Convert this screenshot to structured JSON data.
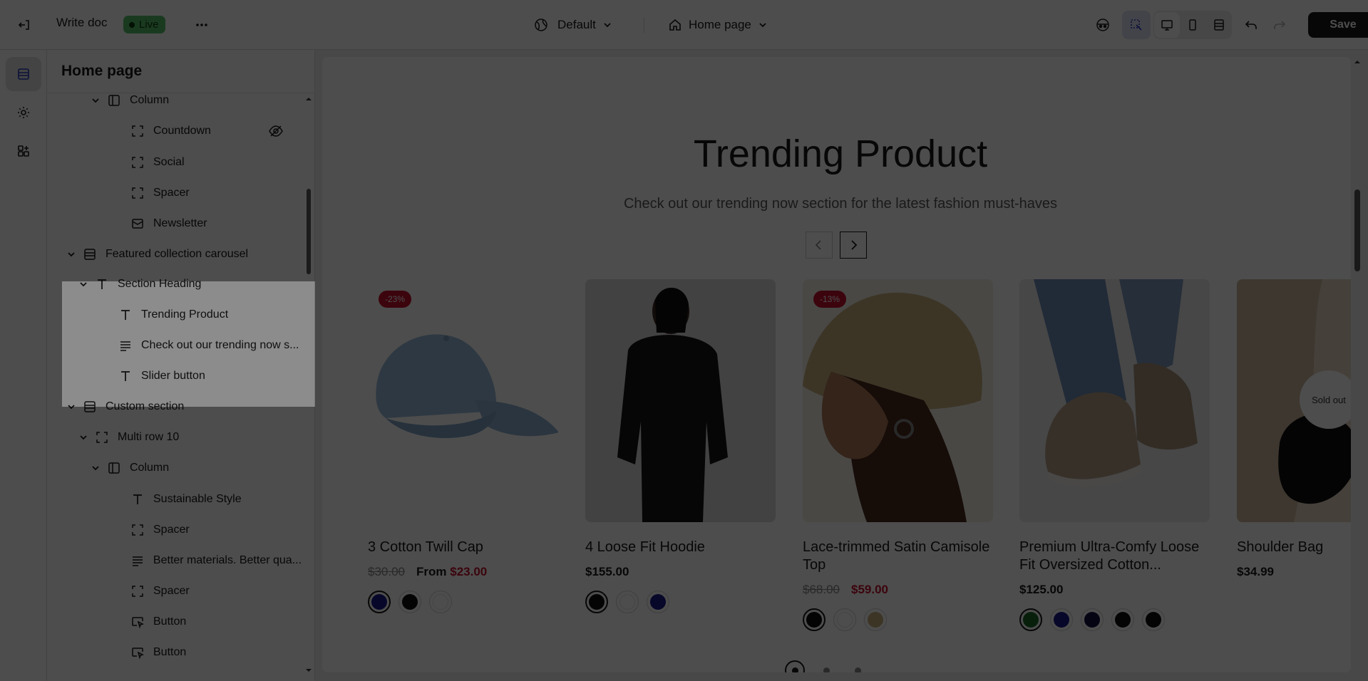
{
  "topbar": {
    "doc_title": "Write doc",
    "live_label": "Live",
    "theme_label": "Default",
    "page_label": "Home page",
    "save_label": "Save"
  },
  "panel": {
    "title": "Home page",
    "rows": [
      {
        "label": "Column",
        "icon": "column-icon",
        "hidden": false
      },
      {
        "label": "Countdown",
        "icon": "block-icon",
        "hidden": true
      },
      {
        "label": "Social",
        "icon": "block-icon",
        "hidden": false
      },
      {
        "label": "Spacer",
        "icon": "block-icon",
        "hidden": false
      },
      {
        "label": "Newsletter",
        "icon": "mail-icon",
        "hidden": false
      },
      {
        "label": "Featured collection carousel",
        "icon": "section-icon",
        "hidden": false
      },
      {
        "label": "Section Heading",
        "icon": "text-icon",
        "hidden": false
      },
      {
        "label": "Trending Product",
        "icon": "text-icon",
        "hidden": false
      },
      {
        "label": "Check out our trending now s...",
        "icon": "paragraph-icon",
        "hidden": false
      },
      {
        "label": "Slider button",
        "icon": "text-icon",
        "hidden": false
      },
      {
        "label": "Custom section",
        "icon": "section-icon",
        "hidden": false
      },
      {
        "label": "Multi row 10",
        "icon": "block-icon",
        "hidden": false
      },
      {
        "label": "Column",
        "icon": "column-icon",
        "hidden": false
      },
      {
        "label": "Sustainable Style",
        "icon": "text-icon",
        "hidden": false
      },
      {
        "label": "Spacer",
        "icon": "block-icon",
        "hidden": false
      },
      {
        "label": "Better materials. Better qua...",
        "icon": "paragraph-icon",
        "hidden": false
      },
      {
        "label": "Spacer",
        "icon": "block-icon",
        "hidden": false
      },
      {
        "label": "Button",
        "icon": "button-icon",
        "hidden": false
      },
      {
        "label": "Button",
        "icon": "button-icon",
        "hidden": false
      }
    ]
  },
  "preview": {
    "heading": "Trending Product",
    "subheading": "Check out our trending now section for the latest fashion must-haves",
    "products": [
      {
        "name": "3 Cotton Twill Cap",
        "badge": "-23%",
        "price_old": "$30.00",
        "price_from": "From",
        "price_sale": "$23.00",
        "price": "",
        "sold_out": ""
      },
      {
        "name": "4 Loose Fit Hoodie",
        "badge": "",
        "price_old": "",
        "price_from": "",
        "price_sale": "",
        "price": "$155.00",
        "sold_out": ""
      },
      {
        "name": "Lace-trimmed Satin Camisole Top",
        "badge": "-13%",
        "price_old": "$68.00",
        "price_from": "",
        "price_sale": "$59.00",
        "price": "",
        "sold_out": ""
      },
      {
        "name": "Premium Ultra-Comfy Loose Fit Oversized Cotton...",
        "badge": "",
        "price_old": "",
        "price_from": "",
        "price_sale": "",
        "price": "$125.00",
        "sold_out": ""
      },
      {
        "name": "Shoulder Bag",
        "badge": "",
        "price_old": "",
        "price_from": "",
        "price_sale": "",
        "price": "$34.99",
        "sold_out": "Sold out"
      }
    ],
    "colors": {
      "accent": "#c8102e",
      "live": "#59c36a",
      "navy": "#1a1a8c",
      "black": "#111111",
      "green": "#1d6b2a"
    }
  }
}
